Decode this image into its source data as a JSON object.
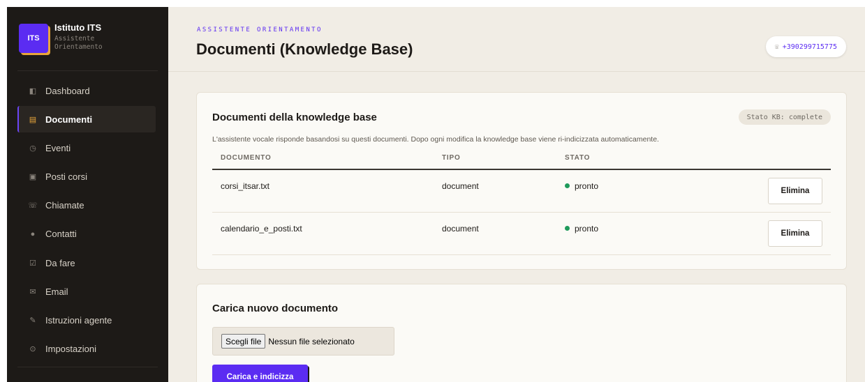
{
  "sidebar": {
    "brand": {
      "logo_text": "ITS",
      "name": "Istituto ITS",
      "subtitle_line1": "Assistente",
      "subtitle_line2": "Orientamento"
    },
    "items": [
      {
        "icon": "dashboard-icon",
        "glyph": "◧",
        "label": "Dashboard"
      },
      {
        "icon": "documents-icon",
        "glyph": "▤",
        "label": "Documenti"
      },
      {
        "icon": "clock-icon",
        "glyph": "◷",
        "label": "Eventi"
      },
      {
        "icon": "calendar-icon",
        "glyph": "▣",
        "label": "Posti corsi"
      },
      {
        "icon": "phone-icon",
        "glyph": "☏",
        "label": "Chiamate"
      },
      {
        "icon": "contact-icon",
        "glyph": "●",
        "label": "Contatti"
      },
      {
        "icon": "checkbox-icon",
        "glyph": "☑",
        "label": "Da fare"
      },
      {
        "icon": "mail-icon",
        "glyph": "✉",
        "label": "Email"
      },
      {
        "icon": "pen-icon",
        "glyph": "✎",
        "label": "Istruzioni agente"
      },
      {
        "icon": "settings-icon",
        "glyph": "⊙",
        "label": "Impostazioni"
      }
    ],
    "active_index": 1
  },
  "header": {
    "eyebrow": "ASSISTENTE ORIENTAMENTO",
    "title": "Documenti (Knowledge Base)",
    "phone_icon": "☏",
    "phone": "+390299715775"
  },
  "kb_card": {
    "title": "Documenti della knowledge base",
    "status_badge": "Stato KB: complete",
    "description": "L'assistente vocale risponde basandosi su questi documenti. Dopo ogni modifica la knowledge base viene ri-indicizzata automaticamente.",
    "columns": [
      "DOCUMENTO",
      "TIPO",
      "STATO"
    ],
    "rows": [
      {
        "name": "corsi_itsar.txt",
        "type": "document",
        "status": "pronto",
        "action": "Elimina"
      },
      {
        "name": "calendario_e_posti.txt",
        "type": "document",
        "status": "pronto",
        "action": "Elimina"
      }
    ]
  },
  "upload_card": {
    "title": "Carica nuovo documento",
    "file_button": "Scegli file",
    "file_status": "Nessun file selezionato",
    "submit_label": "Carica e indicizza"
  },
  "colors": {
    "accent": "#5b2cf2",
    "sidebar_bg": "#1d1a17",
    "status_ok": "#1f9a5b",
    "highlight": "#e8a53a"
  }
}
